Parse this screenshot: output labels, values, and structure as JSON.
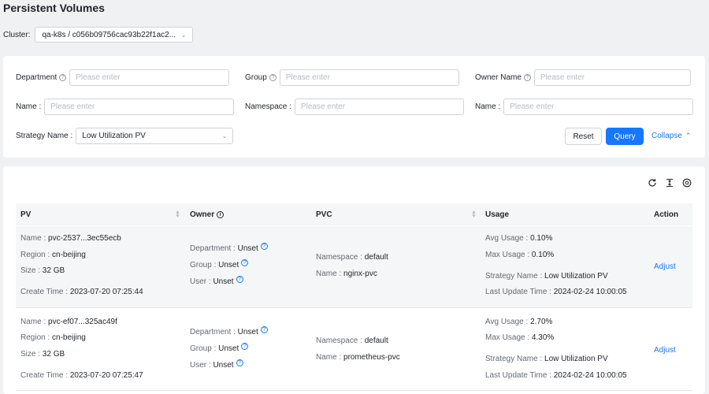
{
  "page": {
    "title": "Persistent Volumes"
  },
  "cluster": {
    "label": "Cluster:",
    "value": "qa-k8s / c056b09756cac93b22f1ac2..."
  },
  "filters": {
    "department": {
      "label": "Department",
      "placeholder": "Please enter"
    },
    "group": {
      "label": "Group",
      "placeholder": "Please enter"
    },
    "owner_name": {
      "label": "Owner Name",
      "placeholder": "Please enter"
    },
    "name1": {
      "label": "Name :",
      "placeholder": "Please enter"
    },
    "namespace": {
      "label": "Namespace :",
      "placeholder": "Please enter"
    },
    "name2": {
      "label": "Name :",
      "placeholder": "Please enter"
    },
    "strategy": {
      "label": "Strategy Name :",
      "value": "Low Utilization PV"
    },
    "reset_label": "Reset",
    "query_label": "Query",
    "collapse_label": "Collapse"
  },
  "table": {
    "columns": {
      "pv": "PV",
      "owner": "Owner",
      "pvc": "PVC",
      "usage": "Usage",
      "action": "Action"
    },
    "rows": [
      {
        "name_label": "Name :",
        "name": "pvc-2537...3ec55ecb",
        "region_label": "Region :",
        "region": "cn-beijing",
        "size_label": "Size :",
        "size": "32 GB",
        "create_label": "Create Time :",
        "create_time": "2023-07-20 07:25:44",
        "dept_label": "Department :",
        "dept": "Unset",
        "group_label": "Group :",
        "group": "Unset",
        "user_label": "User :",
        "user": "Unset",
        "ns_label": "Namespace :",
        "namespace": "default",
        "pvc_name_label": "Name :",
        "pvc_name": "nginx-pvc",
        "avg_label": "Avg Usage :",
        "avg": "0.10%",
        "max_label": "Max Usage :",
        "max": "0.10%",
        "strategy_label": "Strategy Name :",
        "strategy": "Low Utilization PV",
        "update_label": "Last Update Time :",
        "update": "2024-02-24 10:00:05",
        "action": "Adjust"
      },
      {
        "name_label": "Name :",
        "name": "pvc-ef07...325ac49f",
        "region_label": "Region :",
        "region": "cn-beijing",
        "size_label": "Size :",
        "size": "32 GB",
        "create_label": "Create Time :",
        "create_time": "2023-07-20 07:25:47",
        "dept_label": "Department :",
        "dept": "Unset",
        "group_label": "Group :",
        "group": "Unset",
        "user_label": "User :",
        "user": "Unset",
        "ns_label": "Namespace :",
        "namespace": "default",
        "pvc_name_label": "Name :",
        "pvc_name": "prometheus-pvc",
        "avg_label": "Avg Usage :",
        "avg": "2.70%",
        "max_label": "Max Usage :",
        "max": "4.30%",
        "strategy_label": "Strategy Name :",
        "strategy": "Low Utilization PV",
        "update_label": "Last Update Time :",
        "update": "2024-02-24 10:00:05",
        "action": "Adjust"
      }
    ]
  },
  "toolbar": {
    "icons": [
      "refresh-icon",
      "column-height-icon",
      "settings-icon"
    ]
  },
  "colors": {
    "accent": "#1677ff",
    "background": "#f0f1f3"
  }
}
